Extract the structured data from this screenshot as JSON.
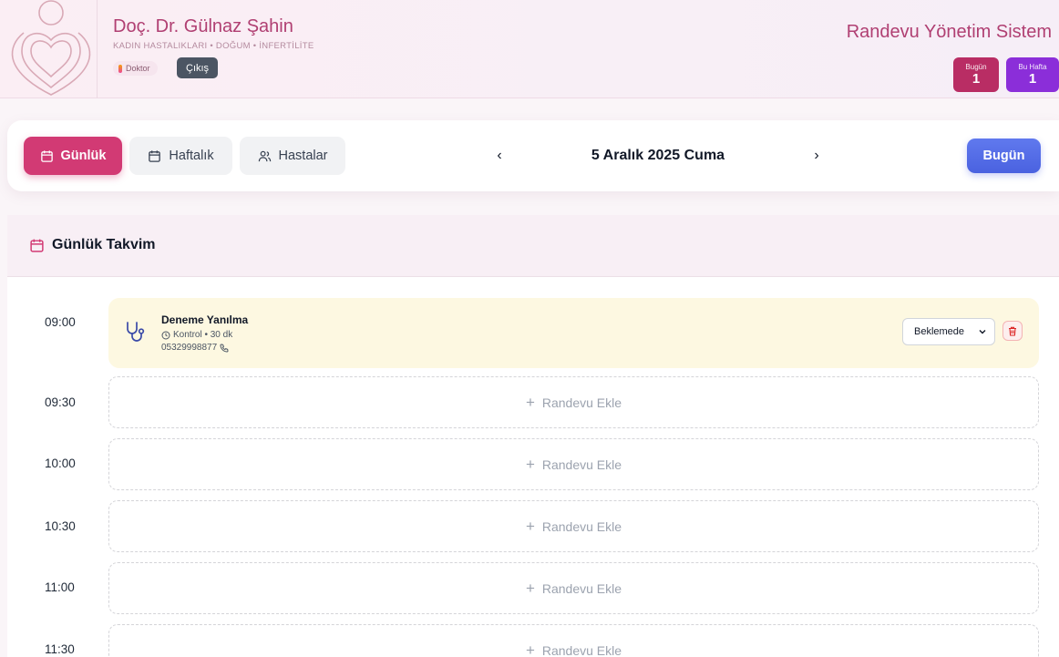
{
  "header": {
    "doctor_name": "Doç. Dr. Gülnaz Şahin",
    "specialty": "KADIN HASTALIKLARI • DOĞUM • İNFERTİLİTE",
    "role_badge": "Doktor",
    "logout_label": "Çıkış",
    "system_title": "Randevu Yönetim Sistem",
    "stats": [
      {
        "label": "Bugün",
        "value": "1"
      },
      {
        "label": "Bu Hafta",
        "value": "1"
      }
    ]
  },
  "nav": {
    "tabs": [
      {
        "label": "Günlük",
        "icon": "calendar-icon",
        "active": true
      },
      {
        "label": "Haftalık",
        "icon": "calendar-icon",
        "active": false
      },
      {
        "label": "Hastalar",
        "icon": "users-icon",
        "active": false
      }
    ],
    "prev_icon": "chevron-left-icon",
    "prev_glyph": "‹",
    "next_glyph": "›",
    "next_icon": "chevron-right-icon",
    "current_date": "5 Aralık 2025 Cuma",
    "today_label": "Bugün"
  },
  "calendar": {
    "title": "Günlük Takvim",
    "appointment": {
      "time": "09:00",
      "patient_name": "Deneme Yanılma",
      "type_duration": "Kontrol • 30 dk",
      "phone": "05329998877",
      "status": "Beklemede"
    },
    "empty_slots": [
      {
        "time": "09:30",
        "label": "Randevu Ekle"
      },
      {
        "time": "10:00",
        "label": "Randevu Ekle"
      },
      {
        "time": "10:30",
        "label": "Randevu Ekle"
      },
      {
        "time": "11:00",
        "label": "Randevu Ekle"
      },
      {
        "time": "11:30",
        "label": "Randevu Ekle"
      }
    ]
  },
  "colors": {
    "brand": "#b03f72",
    "active_tab": "#d23a74",
    "today_button": "#4a62e0",
    "stat_today": "#b92d64",
    "stat_week": "#8b2ed9",
    "appointment_bg": "#fdf8e1"
  }
}
